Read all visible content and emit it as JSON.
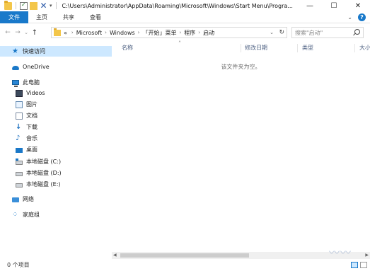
{
  "window": {
    "title": "C:\\Users\\Administrator\\AppData\\Roaming\\Microsoft\\Windows\\Start Menu\\Progra..."
  },
  "ribbon": {
    "tabs": [
      "文件",
      "主页",
      "共享",
      "查看"
    ]
  },
  "address": {
    "crumbs": [
      "Microsoft",
      "Windows",
      "「开始」菜单",
      "程序",
      "启动"
    ],
    "overflow_marker": "«"
  },
  "search": {
    "placeholder": "搜索\"启动\""
  },
  "nav_pane": {
    "items": [
      {
        "label": "快速访问",
        "icon": "quick-access-star-icon"
      },
      {
        "label": "OneDrive",
        "icon": "onedrive-cloud-icon"
      },
      {
        "label": "此电脑",
        "icon": "this-pc-icon"
      },
      {
        "label": "Videos",
        "icon": "videos-icon"
      },
      {
        "label": "图片",
        "icon": "pictures-icon"
      },
      {
        "label": "文档",
        "icon": "documents-icon"
      },
      {
        "label": "下载",
        "icon": "downloads-icon"
      },
      {
        "label": "音乐",
        "icon": "music-icon"
      },
      {
        "label": "桌面",
        "icon": "desktop-icon"
      },
      {
        "label": "本地磁盘 (C:)",
        "icon": "drive-icon"
      },
      {
        "label": "本地磁盘 (D:)",
        "icon": "drive-icon"
      },
      {
        "label": "本地磁盘 (E:)",
        "icon": "drive-icon"
      },
      {
        "label": "网络",
        "icon": "network-icon"
      },
      {
        "label": "家庭组",
        "icon": "homegroup-icon"
      }
    ]
  },
  "content": {
    "columns": [
      "名称",
      "修改日期",
      "类型",
      "大小"
    ],
    "empty_message": "该文件夹为空。"
  },
  "status": {
    "item_count": "0 个项目"
  },
  "colors": {
    "accent": "#1979ca",
    "selection": "#cde8ff",
    "header_text": "#4d6082"
  }
}
